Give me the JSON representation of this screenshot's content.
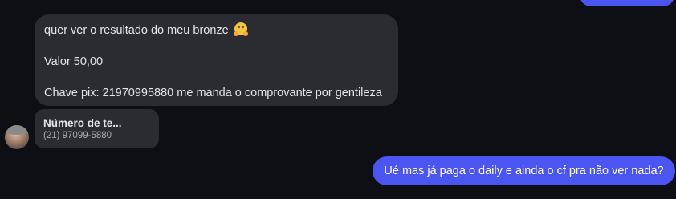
{
  "incoming_message": {
    "line1": "quer ver o resultado do meu bronze",
    "emoji_icon": "hugging-face-emoji",
    "line2": "Valor 50,00",
    "line3": "Chave pix: 21970995880 me manda o comprovante por gentileza"
  },
  "contact_card": {
    "name": "Número de te...",
    "phone": "(21) 97099-5880"
  },
  "outgoing_message": {
    "text": "Ué mas já paga o daily e ainda o cf pra não ver nada?"
  },
  "colors": {
    "background": "#0d0f14",
    "incoming_bubble": "#2a2c31",
    "outgoing_bubble": "#4a55f2"
  }
}
